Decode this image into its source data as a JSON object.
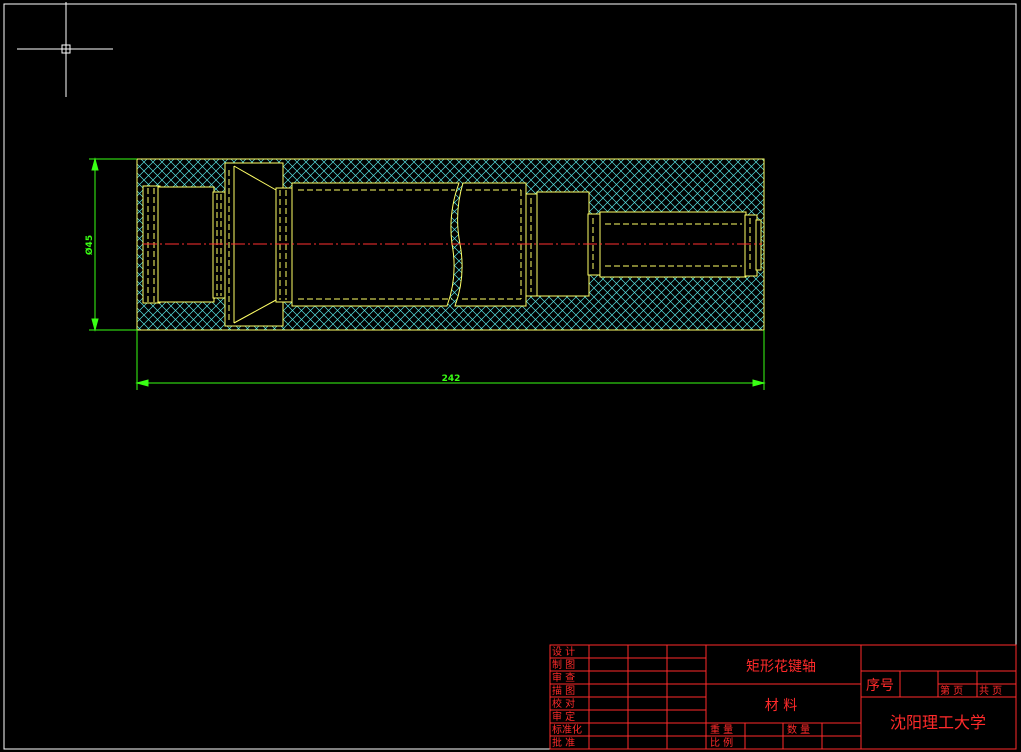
{
  "drawing": {
    "dimensions": {
      "length": "242",
      "diameter": "Ø45"
    },
    "colors": {
      "background": "#000000",
      "border": "#ffffff",
      "part_outline": "#ffff66",
      "hatch": "#59e0e0",
      "centerline": "#ff3030",
      "dimension": "#39ff14",
      "title_block": "#ff2a2a"
    }
  },
  "title_block": {
    "part_name": "矩形花键轴",
    "material_label": "材  料",
    "weight_label": "重  量",
    "quantity_label": "数  量",
    "scale_label": "比  例",
    "serial_label": "序号",
    "sheet_label": "第  页",
    "total_label": "共  页",
    "school": "沈阳理工大学",
    "roles": [
      "设  计",
      "制  图",
      "审  查",
      "描  图",
      "校  对",
      "审  定",
      "标准化",
      "批  准"
    ]
  }
}
